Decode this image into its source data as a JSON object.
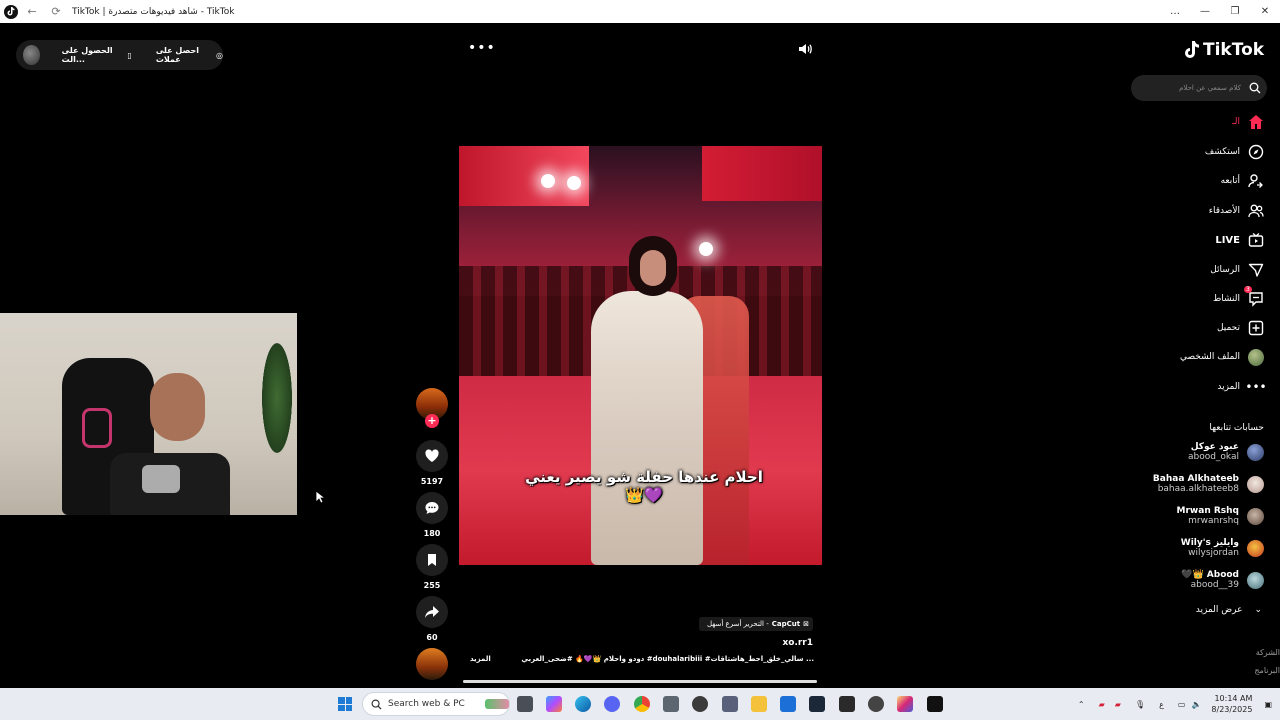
{
  "window": {
    "title": "TikTok | شاهد فيديوهات متصدرة - TikTok",
    "controls": [
      "…",
      "—",
      "❐",
      "✕"
    ]
  },
  "top_pill": {
    "get_coins": "احصل على عملات",
    "get_app": "الحصول على الت..."
  },
  "logo": {
    "text": "TikTok"
  },
  "search": {
    "placeholder": "كلام سمعي عن احلام"
  },
  "nav": [
    {
      "label": "الـ",
      "icon": "home-icon",
      "active": true
    },
    {
      "label": "استكشف",
      "icon": "compass-icon"
    },
    {
      "label": "أتابعه",
      "icon": "user-follow-icon"
    },
    {
      "label": "الأصدقاء",
      "icon": "friends-icon"
    },
    {
      "label": "LIVE",
      "icon": "live-icon"
    },
    {
      "label": "الرسائل",
      "icon": "messages-icon"
    },
    {
      "label": "النشاط",
      "icon": "activity-icon",
      "badge": "3"
    },
    {
      "label": "تحميل",
      "icon": "upload-icon"
    },
    {
      "label": "الملف الشخصي",
      "icon": "profile-avatar"
    },
    {
      "label": "المزيد",
      "icon": "more-icon"
    }
  ],
  "following": {
    "title": "حسابات تتابعها",
    "accounts": [
      {
        "name": "عبود عوكل",
        "handle": "abood_okal"
      },
      {
        "name": "Bahaa Alkhateeb",
        "handle": "bahaa.alkhateeb8"
      },
      {
        "name": "Mrwan Rshq",
        "handle": "mrwanrshq"
      },
      {
        "name": "Wily's وايليز",
        "handle": "wilysjordan"
      },
      {
        "name": "🖤👑 Abood",
        "handle": "abood__39"
      }
    ],
    "see_more": "عرض المزيد"
  },
  "footer_links": [
    "الشركة",
    "البرنامج"
  ],
  "video": {
    "caption": "احلام عندها حفلة شو يصير يعني 👑💜",
    "likes": "5197",
    "comments": "180",
    "saves": "255",
    "shares": "60",
    "capcut_brand": "CapCut",
    "capcut_text": "التحرير أسرع أسهل -",
    "author": "xo.rr1",
    "description": "دودو واحلام 👑💜🔥 #ضحى_العربي #douhalaribiii #سالي_خلق_احط_هاشتاقات ...",
    "more_label": "المزيد",
    "progress": 1.0
  },
  "taskbar": {
    "search_label": "Search web & PC",
    "time": "10:14 AM",
    "date": "8/23/2025",
    "lang": "ع"
  },
  "colors": {
    "accent": "#fe2c55",
    "bg": "#000000",
    "taskbar": "#e8ecf2"
  }
}
